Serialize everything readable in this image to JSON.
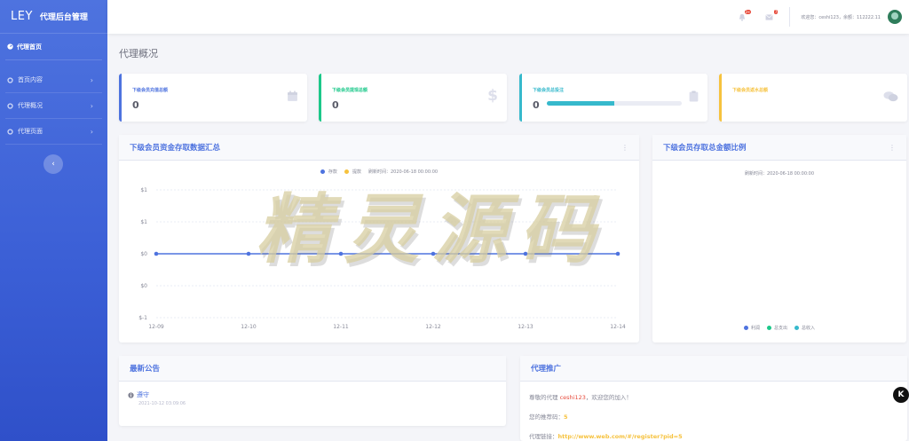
{
  "brand": {
    "logo": "LEY",
    "name": "代理后台管理"
  },
  "sidebar": {
    "home": "代理首页",
    "items": [
      {
        "label": "首页内容"
      },
      {
        "label": "代理概况"
      },
      {
        "label": "代理页面"
      }
    ]
  },
  "topbar": {
    "bell_badge": "3+",
    "mail_badge": "7",
    "welcome": "欢迎您：ceshi123，余额：112222.11"
  },
  "page_title": "代理概况",
  "stats": [
    {
      "label": "下级会员充值总额",
      "value": "0",
      "color": "#4e73df",
      "icon": "calendar-icon"
    },
    {
      "label": "下级会员提现总额",
      "value": "0",
      "color": "#1cc88a",
      "icon": "dollar-icon"
    },
    {
      "label": "下级会员总投注",
      "value": "0",
      "color": "#36b9cc",
      "icon": "clipboard-icon",
      "progress": 0.5
    },
    {
      "label": "下级会员返水总额",
      "value": "",
      "color": "#f6c23e",
      "icon": "comments-icon"
    }
  ],
  "area_card": {
    "title": "下级会员资金存取数据汇总",
    "legend": [
      {
        "name": "存款",
        "color": "#4e73df"
      },
      {
        "name": "提款",
        "color": "#f6c23e"
      }
    ],
    "refresh": "刷新时间：2020-06-18 00:00:00"
  },
  "pie_card": {
    "title": "下级会员存取总金额比例",
    "refresh": "刷新时间：2020-06-18 00:00:00",
    "legend": [
      {
        "name": "利润",
        "color": "#4e73df"
      },
      {
        "name": "总支出",
        "color": "#1cc88a"
      },
      {
        "name": "总收入",
        "color": "#36b9cc"
      }
    ]
  },
  "notice_card": {
    "title": "最新公告",
    "items": [
      {
        "text": "遵守",
        "date": "2021-10-12 03:09:06"
      }
    ]
  },
  "promo_card": {
    "title": "代理推广",
    "greeting_prefix": "尊敬的代理 ",
    "agent": "ceshi123",
    "greeting_suffix": "，欢迎您的加入！",
    "code_label": "您的推荐码：",
    "code": "5",
    "link_label": "代理链接：",
    "link": "http://www.web.com/#/register?pid=5"
  },
  "watermark": "精灵源码",
  "float_button": "K",
  "chart_data": {
    "type": "line",
    "categories": [
      "12-09",
      "12-10",
      "12-11",
      "12-12",
      "12-13",
      "12-14"
    ],
    "series": [
      {
        "name": "存款",
        "values": [
          0,
          0,
          0,
          0,
          0,
          0
        ],
        "color": "#4e73df"
      }
    ],
    "y_ticks": [
      "$1",
      "$1",
      "$0",
      "$0",
      "$-1"
    ],
    "ylim": [
      -1,
      1
    ],
    "grid": true,
    "legend": "top-center"
  }
}
